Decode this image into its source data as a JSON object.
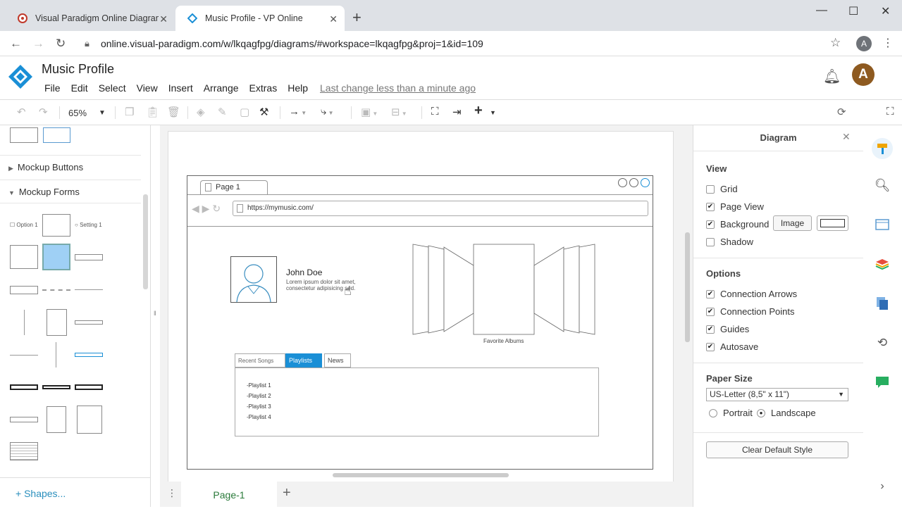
{
  "browser": {
    "tabs": [
      {
        "title": "Visual Paradigm Online Diagrams",
        "active": false
      },
      {
        "title": "Music Profile - VP Online",
        "active": true
      }
    ],
    "url": "online.visual-paradigm.com/w/lkqagfpg/diagrams/#workspace=lkqagfpg&proj=1&id=109",
    "profile_initial": "A"
  },
  "app": {
    "title": "Music Profile",
    "menu": [
      "File",
      "Edit",
      "Select",
      "View",
      "Insert",
      "Arrange",
      "Extras",
      "Help"
    ],
    "last_change": "Last change less than a minute ago",
    "avatar_initial": "A",
    "accent": "#1a8fd6"
  },
  "toolbar": {
    "zoom": "65%"
  },
  "left_panel": {
    "sections": [
      {
        "label": "Mockup Buttons",
        "expanded": false
      },
      {
        "label": "Mockup Forms",
        "expanded": true
      }
    ],
    "shape_labels": [
      "Option 1",
      "Setting 1"
    ],
    "shapes_link": "Shapes..."
  },
  "canvas": {
    "page_tab": "Page-1",
    "mockup": {
      "tab_label": "Page 1",
      "url": "https://mymusic.com/",
      "name": "John Doe",
      "bio_line1": "Lorem ipsum dolor sit amet,",
      "bio_line2": "consectetur adipisicing sed.",
      "album_caption": "Favorite Albums",
      "tabs": [
        "Recent Songs",
        "Playlists",
        "News"
      ],
      "active_tab": "Playlists",
      "playlists": [
        "-Playlist 1",
        "-Playlist 2",
        "-Playlist 3",
        "-Playlist 4"
      ]
    }
  },
  "right_panel": {
    "title": "Diagram",
    "view_heading": "View",
    "view_options": [
      {
        "label": "Grid",
        "checked": false
      },
      {
        "label": "Page View",
        "checked": true
      },
      {
        "label": "Background",
        "checked": true
      },
      {
        "label": "Shadow",
        "checked": false
      }
    ],
    "image_button": "Image",
    "options_heading": "Options",
    "options": [
      {
        "label": "Connection Arrows",
        "checked": true
      },
      {
        "label": "Connection Points",
        "checked": true
      },
      {
        "label": "Guides",
        "checked": true
      },
      {
        "label": "Autosave",
        "checked": true
      }
    ],
    "paper_size_heading": "Paper Size",
    "paper_size": "US-Letter (8,5\" x 11\")",
    "orientation": [
      {
        "label": "Portrait",
        "selected": false
      },
      {
        "label": "Landscape",
        "selected": true
      }
    ],
    "clear_button": "Clear Default Style"
  }
}
